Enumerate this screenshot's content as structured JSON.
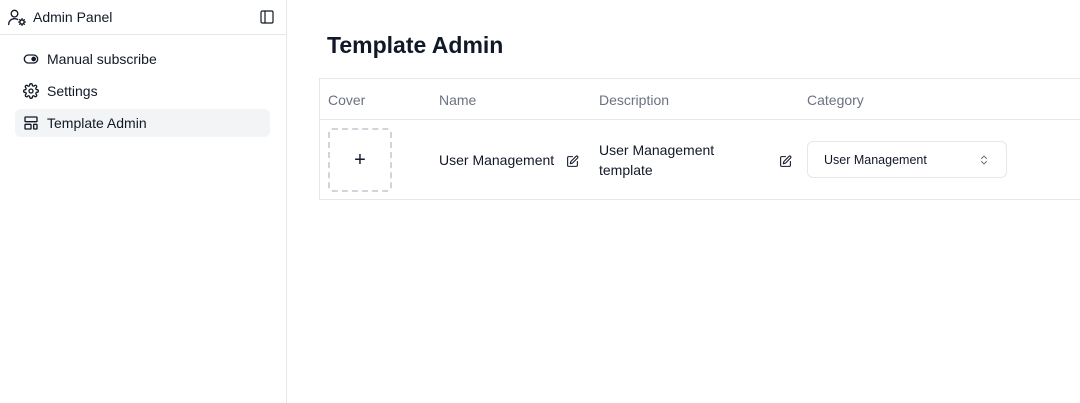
{
  "sidebar": {
    "title": "Admin Panel",
    "header_icon": "user-gear-icon",
    "toggle_icon": "sidebar-toggle-icon",
    "items": [
      {
        "label": "Manual subscribe",
        "icon": "toggle-icon",
        "active": false
      },
      {
        "label": "Settings",
        "icon": "gear-icon",
        "active": false
      },
      {
        "label": "Template Admin",
        "icon": "layout-template-icon",
        "active": true
      }
    ]
  },
  "main": {
    "title": "Template Admin",
    "table": {
      "columns": [
        "Cover",
        "Name",
        "Description",
        "Category"
      ],
      "rows": [
        {
          "cover_add": "+",
          "name": "User Management",
          "description": "User Management template",
          "category": "User Management"
        }
      ]
    }
  },
  "colors": {
    "border": "#e5e7eb",
    "active_bg": "#f3f4f6",
    "muted_text": "#6b7280",
    "text": "#111827"
  }
}
